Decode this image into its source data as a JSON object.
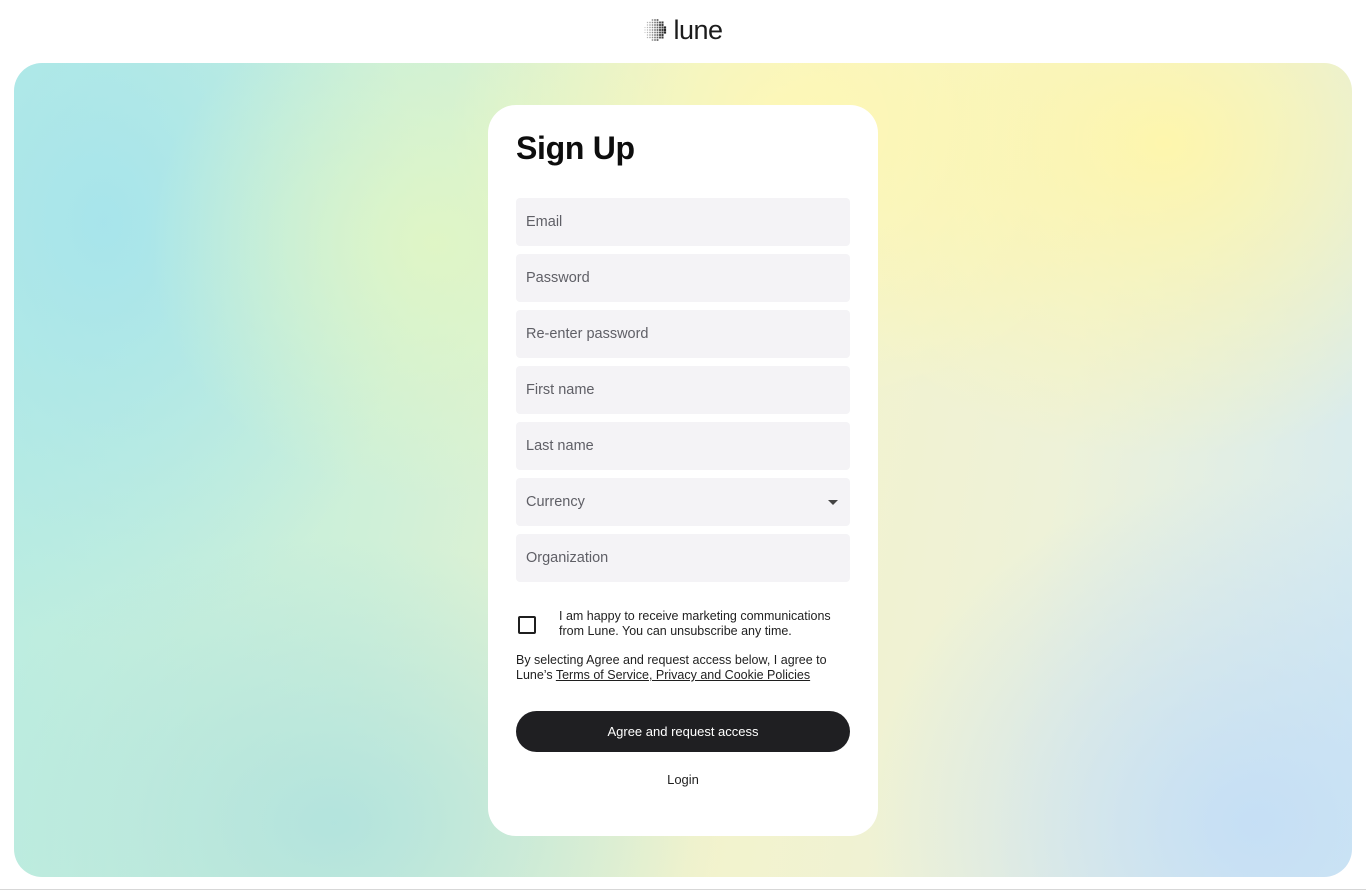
{
  "brand": {
    "logo_icon": "lune-dot-sphere-icon",
    "name": "lune"
  },
  "signup": {
    "title": "Sign Up",
    "fields": {
      "email_placeholder": "Email",
      "password_placeholder": "Password",
      "reenter_password_placeholder": "Re-enter password",
      "first_name_placeholder": "First name",
      "last_name_placeholder": "Last name",
      "currency_label": "Currency",
      "organization_placeholder": "Organization"
    },
    "marketing_checkbox": {
      "checked": false,
      "label": "I am happy to receive marketing communications from Lune. You can unsubscribe any time."
    },
    "terms": {
      "prefix": "By selecting Agree and request access below, I agree to Lune’s ",
      "link_text": "Terms of Service, Privacy and Cookie Policies"
    },
    "submit_label": "Agree and request access",
    "login_label": "Login"
  },
  "colors": {
    "button_bg": "#1f1f22",
    "field_bg": "#f4f3f6",
    "card_bg": "#ffffff"
  }
}
